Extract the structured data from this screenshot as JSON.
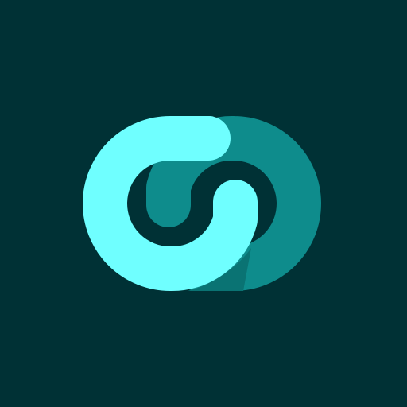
{
  "icon": {
    "name": "interlinked-loops-logo-icon",
    "colors": {
      "background": "#003135",
      "loop_light": "#6FFFFF",
      "loop_light_shade": "#5BE3E6",
      "loop_dark": "#0E8C8C",
      "loop_dark_shade": "#0A7373",
      "overlap_tint": "#7CE6E3"
    }
  }
}
